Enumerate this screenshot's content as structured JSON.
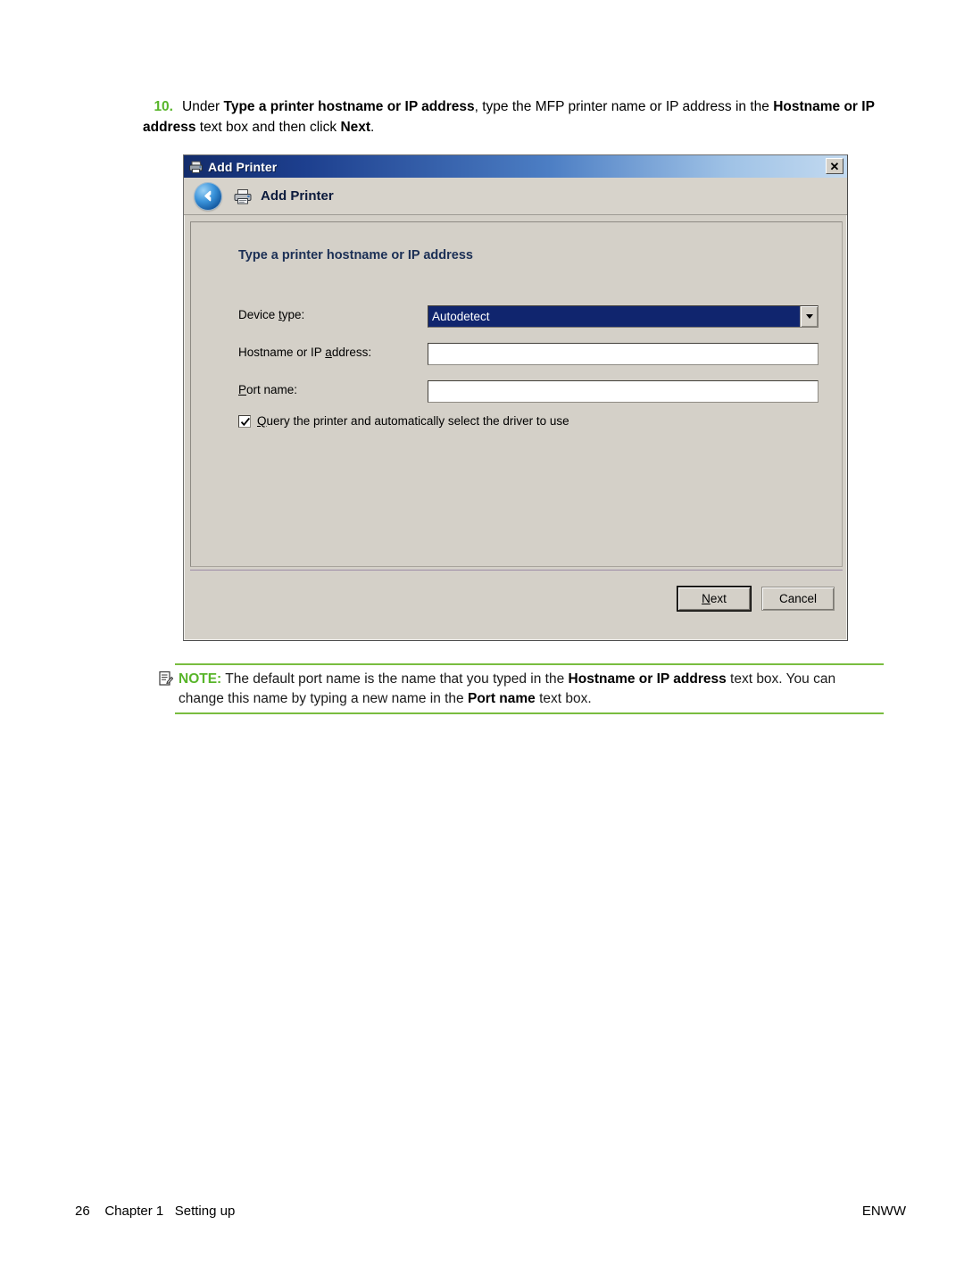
{
  "step": {
    "number": "10.",
    "text_parts": [
      {
        "t": "Under ",
        "b": false
      },
      {
        "t": "Type a printer hostname or IP address",
        "b": true
      },
      {
        "t": ", type the MFP printer name or IP address in the ",
        "b": false
      },
      {
        "t": "Hostname or IP address",
        "b": true
      },
      {
        "t": " text box and then click ",
        "b": false
      },
      {
        "t": "Next",
        "b": true
      },
      {
        "t": ".",
        "b": false
      }
    ]
  },
  "dialog": {
    "titlebar": {
      "title": "Add Printer",
      "icon": "printer-icon",
      "close_label": "✕"
    },
    "nav": {
      "back_icon": "back-arrow-icon",
      "printer_icon": "printer-icon",
      "title": "Add Printer"
    },
    "panel": {
      "heading": "Type a printer hostname or IP address",
      "fields": {
        "device_type": {
          "label_pre": "Device ",
          "label_key": "t",
          "label_post": "ype:",
          "value": "Autodetect",
          "dropdown_icon": "chevron-down-icon"
        },
        "hostname": {
          "label_pre": "Hostname or IP ",
          "label_key": "a",
          "label_post": "ddress:",
          "value": "",
          "placeholder": ""
        },
        "port_name": {
          "label_pre": "",
          "label_key": "P",
          "label_post": "ort name:",
          "value": "",
          "placeholder": ""
        }
      },
      "checkbox": {
        "checked": true,
        "label_pre": "",
        "label_key": "Q",
        "label_post": "uery the printer and automatically select the driver to use"
      }
    },
    "buttons": {
      "next": {
        "pre": "",
        "key": "N",
        "post": "ext",
        "default": true
      },
      "cancel": {
        "pre": "Cancel",
        "key": "",
        "post": "",
        "default": false
      }
    }
  },
  "note": {
    "icon": "note-icon",
    "label": "NOTE:",
    "text_parts": [
      {
        "t": "   The default port name is the name that you typed in the ",
        "b": false
      },
      {
        "t": "Hostname or IP address",
        "b": true
      },
      {
        "t": " text box. You can change this name by typing a new name in the ",
        "b": false
      },
      {
        "t": "Port name",
        "b": true
      },
      {
        "t": " text box.",
        "b": false
      }
    ]
  },
  "footer": {
    "left": "26    Chapter 1   Setting up",
    "right": "ENWW"
  },
  "colors": {
    "accent_green": "#58b52a",
    "rule_green": "#79bd3f",
    "title_gradient_start": "#132c6b",
    "title_gradient_end": "#c3daf0",
    "dialog_face": "#d4d0c8",
    "combo_selection": "#10256e"
  }
}
